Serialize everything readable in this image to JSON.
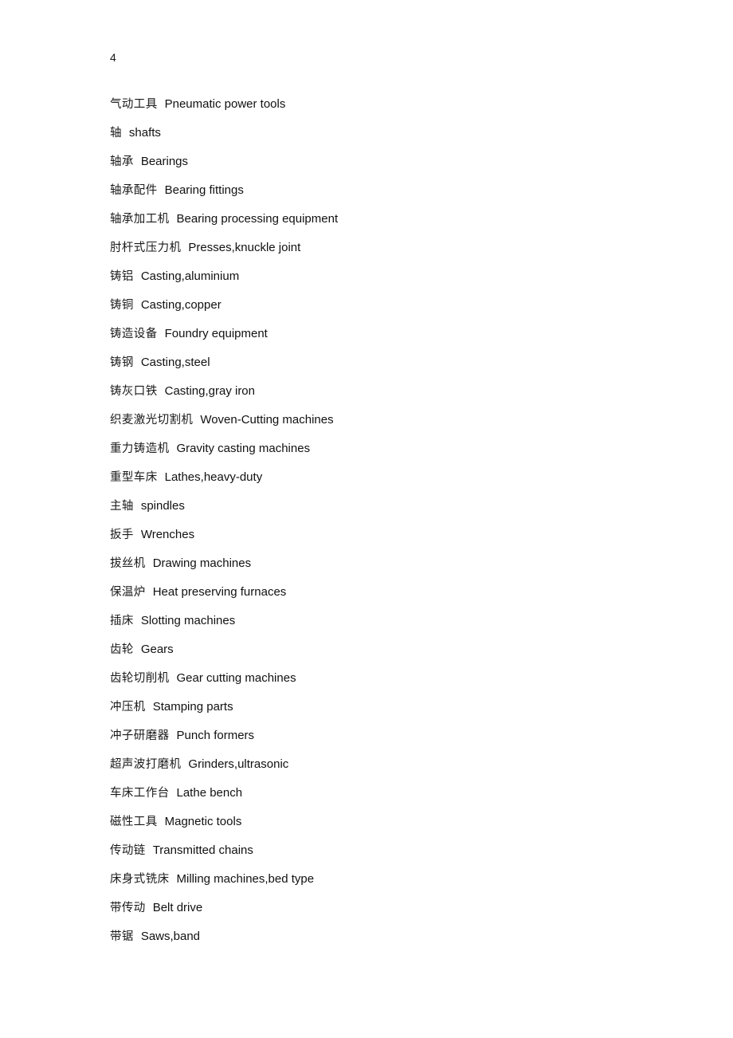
{
  "document": {
    "page_number": "4",
    "glossary_title": "",
    "entries": [
      {
        "zh": "气动工具",
        "en": "Pneumatic  power  tools"
      },
      {
        "zh": "轴",
        "en": "shafts"
      },
      {
        "zh": "轴承",
        "en": "Bearings"
      },
      {
        "zh": "轴承配件",
        "en": "Bearing  fittings"
      },
      {
        "zh": "轴承加工机",
        "en": "Bearing  processing  equipment"
      },
      {
        "zh": "肘杆式压力机",
        "en": "Presses,knuckle  joint"
      },
      {
        "zh": "铸铝",
        "en": "Casting,aluminium"
      },
      {
        "zh": "铸铜",
        "en": "Casting,copper"
      },
      {
        "zh": "铸造设备",
        "en": "Foundry  equipment"
      },
      {
        "zh": "铸钢",
        "en": "Casting,steel"
      },
      {
        "zh": "铸灰口铁",
        "en": "Casting,gray  iron"
      },
      {
        "zh": "织麦激光切割机",
        "en": "Woven-Cutting  machines"
      },
      {
        "zh": "重力铸造机",
        "en": "Gravity  casting  machines"
      },
      {
        "zh": "重型车床",
        "en": "Lathes,heavy-duty"
      },
      {
        "zh": "主轴",
        "en": "spindles"
      },
      {
        "zh": "扳手",
        "en": "Wrenches"
      },
      {
        "zh": "拔丝机",
        "en": "Drawing  machines"
      },
      {
        "zh": "保温炉",
        "en": "Heat  preserving  furnaces"
      },
      {
        "zh": "插床",
        "en": "Slotting  machines"
      },
      {
        "zh": "齿轮",
        "en": "Gears"
      },
      {
        "zh": "齿轮切削机",
        "en": "Gear  cutting  machines"
      },
      {
        "zh": "冲压机",
        "en": "Stamping  parts"
      },
      {
        "zh": "冲子研磨器",
        "en": "Punch  formers"
      },
      {
        "zh": "超声波打磨机",
        "en": "Grinders,ultrasonic"
      },
      {
        "zh": "车床工作台",
        "en": "Lathe  bench"
      },
      {
        "zh": "磁性工具",
        "en": "Magnetic  tools"
      },
      {
        "zh": "传动链",
        "en": "Transmitted  chains"
      },
      {
        "zh": "床身式铣床",
        "en": "Milling  machines,bed  type"
      },
      {
        "zh": "带传动",
        "en": "Belt  drive"
      },
      {
        "zh": "带锯",
        "en": "Saws,band"
      }
    ]
  }
}
